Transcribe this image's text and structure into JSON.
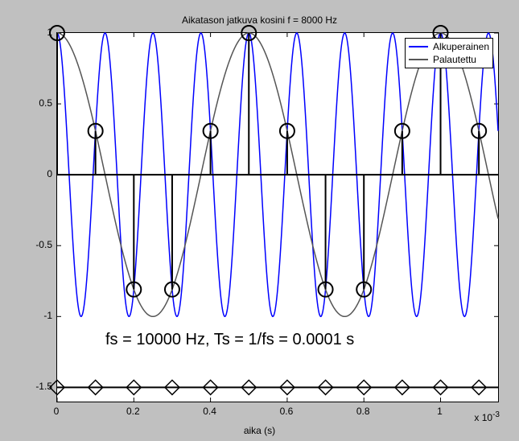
{
  "chart_data": {
    "type": "line",
    "title": "Aikatason jatkuva kosini f = 8000 Hz",
    "xlabel": "aika (s)",
    "ylabel": "",
    "xlim": [
      0,
      0.00115
    ],
    "ylim": [
      -1.6,
      1
    ],
    "x_ticks": [
      0,
      0.0002,
      0.0004,
      0.0006,
      0.0008,
      0.001
    ],
    "x_tick_labels": [
      "0",
      "0.2",
      "0.4",
      "0.6",
      "0.8",
      "1"
    ],
    "x_offset_label": "x 10^{-3}",
    "y_ticks": [
      -1.5,
      -1,
      -0.5,
      0,
      0.5,
      1
    ],
    "y_tick_labels": [
      "-1.5",
      "-1",
      "-0.5",
      "0",
      "0.5",
      "1"
    ],
    "legend": [
      "Alkuperainen",
      "Palautettu"
    ],
    "colors": {
      "Alkuperainen": "#0000ff",
      "Palautettu": "#555555",
      "stems": "#000000"
    },
    "annotation": "fs = 10000 Hz, Ts = 1/fs = 0.0001 s",
    "series": [
      {
        "name": "Alkuperainen",
        "kind": "continuous",
        "function": "cos(2*pi*8000*x)",
        "frequency_hz": 8000
      },
      {
        "name": "Palautettu",
        "kind": "continuous",
        "function": "cos(2*pi*2000*x)",
        "frequency_hz": 2000
      },
      {
        "name": "samples",
        "kind": "stem_circle",
        "x": [
          0,
          0.0001,
          0.0002,
          0.0003,
          0.0004,
          0.0005,
          0.0006,
          0.0007,
          0.0008,
          0.0009,
          0.001,
          0.0011
        ],
        "y": [
          1.0,
          0.309,
          -0.809,
          -0.809,
          0.309,
          1.0,
          0.309,
          -0.809,
          -0.809,
          0.309,
          1.0,
          0.309
        ]
      },
      {
        "name": "baseline_diamonds",
        "kind": "stem_diamond",
        "y_const": -1.5,
        "x": [
          0,
          0.0001,
          0.0002,
          0.0003,
          0.0004,
          0.0005,
          0.0006,
          0.0007,
          0.0008,
          0.0009,
          0.001,
          0.0011
        ]
      }
    ]
  }
}
